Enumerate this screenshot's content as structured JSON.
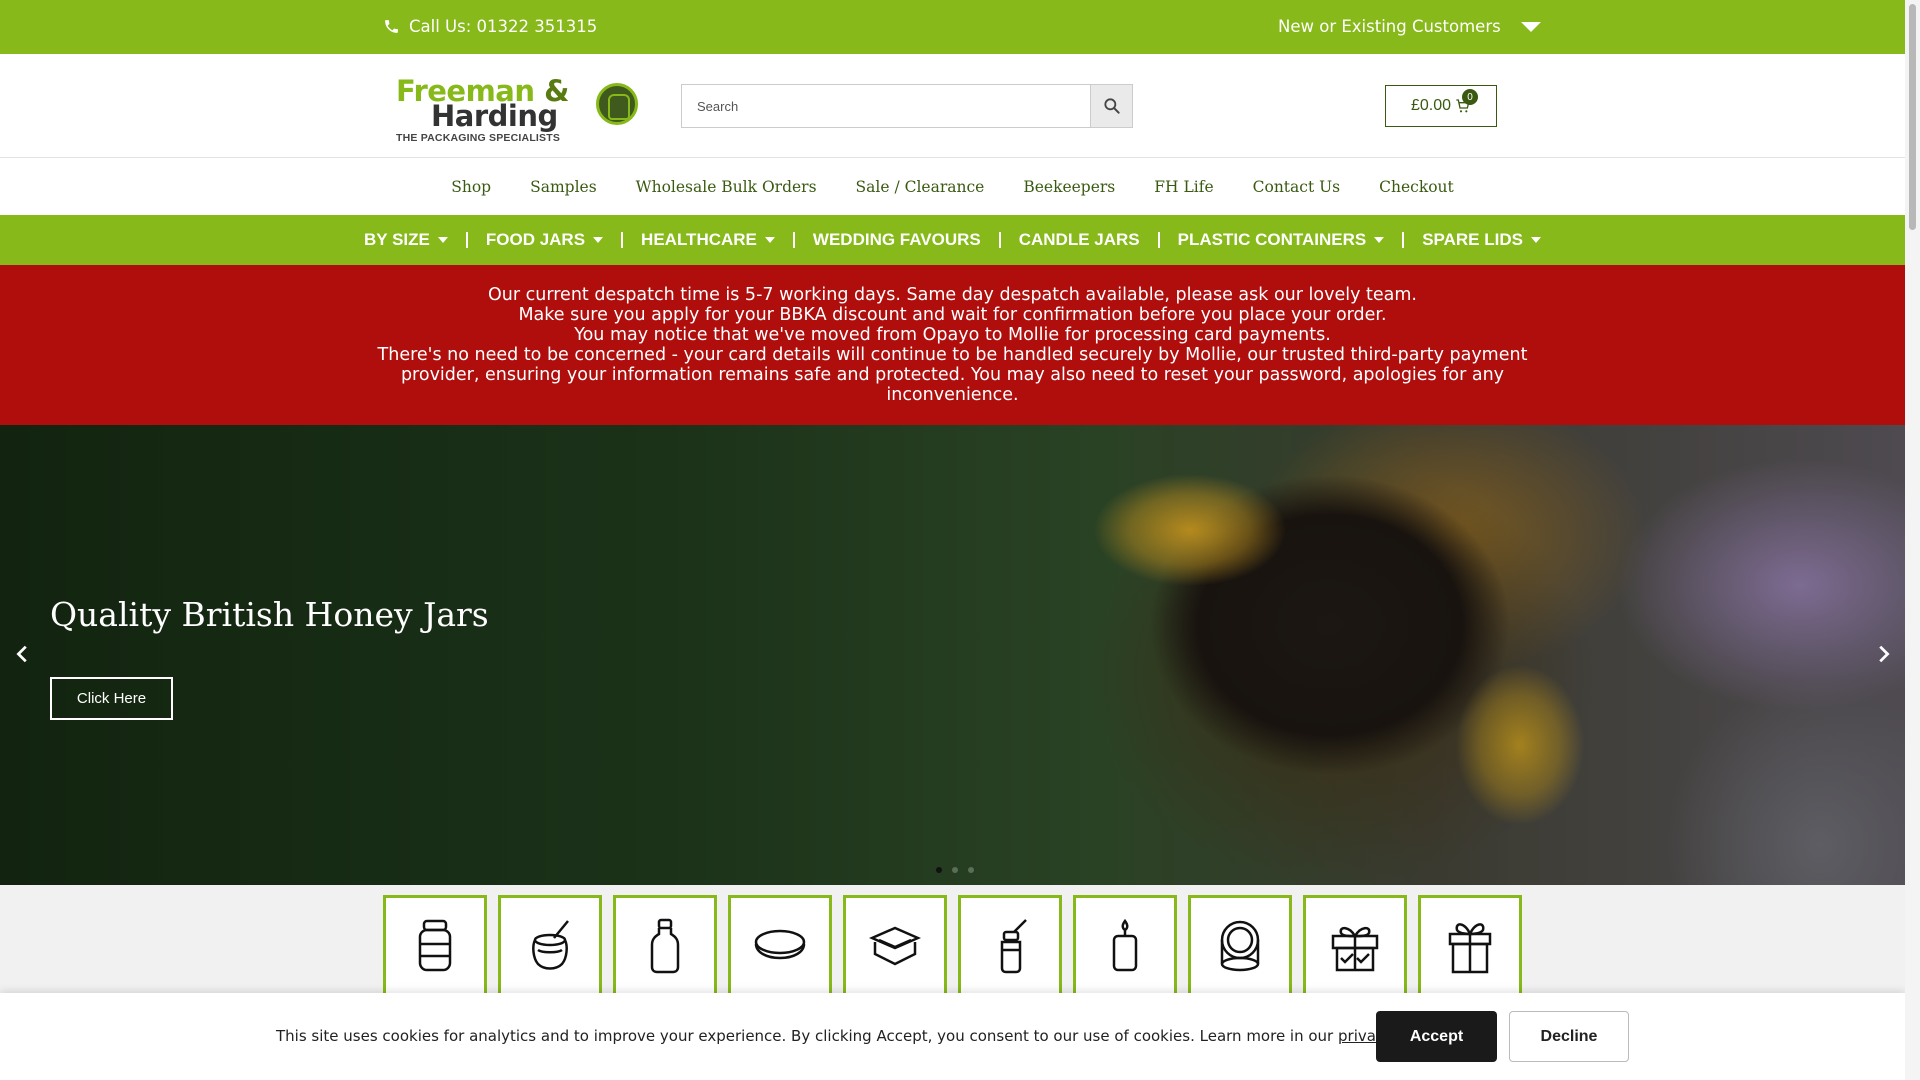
{
  "topbar": {
    "call": "Call Us: 01322 351315",
    "customers": "New or Existing Customers"
  },
  "logo": {
    "line1": "Freeman",
    "amp": "&",
    "line2": "Harding",
    "tagline": "THE PACKAGING SPECIALISTS"
  },
  "search": {
    "placeholder": "Search"
  },
  "cart": {
    "total": "£0.00",
    "count": "0"
  },
  "main_nav": [
    "Shop",
    "Samples",
    "Wholesale Bulk Orders",
    "Sale / Clearance",
    "Beekeepers",
    "FH Life",
    "Contact Us",
    "Checkout"
  ],
  "categories": [
    {
      "label": "BY SIZE",
      "dropdown": true
    },
    {
      "label": "FOOD JARS",
      "dropdown": true
    },
    {
      "label": "HEALTHCARE",
      "dropdown": true
    },
    {
      "label": "WEDDING FAVOURS",
      "dropdown": false
    },
    {
      "label": "CANDLE JARS",
      "dropdown": false
    },
    {
      "label": "PLASTIC CONTAINERS",
      "dropdown": true
    },
    {
      "label": "SPARE LIDS",
      "dropdown": true
    }
  ],
  "notice": {
    "lines": [
      "Our current despatch time is 5-7 working days. Same day despatch available, please ask our lovely team.",
      "Make sure you apply for your BBKA discount and wait for confirmation before you place your order.",
      "You may notice that we've moved from Opayo to Mollie for processing card payments.",
      "There's no need to be concerned - your card details will continue to be handled securely by Mollie, our trusted third-party payment provider, ensuring your information remains safe and protected. You may also need to reset your password, apologies for any inconvenience."
    ]
  },
  "hero": {
    "title": "Quality British Honey Jars",
    "cta": "Click Here",
    "active_slide": 1,
    "slide_count": 3
  },
  "tiles": [
    {
      "icon": "jar-icon"
    },
    {
      "icon": "honey-pot-icon"
    },
    {
      "icon": "bottle-icon"
    },
    {
      "icon": "lid-icon"
    },
    {
      "icon": "plastic-container-icon"
    },
    {
      "icon": "dropper-bottle-icon"
    },
    {
      "icon": "candle-icon"
    },
    {
      "icon": "compact-icon"
    },
    {
      "icon": "gift-icon"
    },
    {
      "icon": "gift-box-icon"
    }
  ],
  "cookie": {
    "message": "This site uses cookies for analytics and to improve your experience. By clicking Accept, you consent to our use of cookies. Learn more in our",
    "link": "privacy policy",
    "end": ".",
    "accept": "Accept",
    "decline": "Decline"
  },
  "colors": {
    "brand_green": "#86b919",
    "dark_green": "#3a5a12",
    "notice_red": "#b00d0d"
  }
}
